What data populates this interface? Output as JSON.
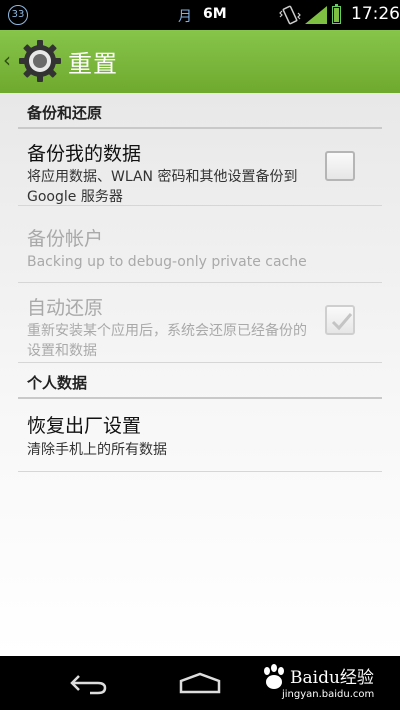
{
  "status_bar": {
    "notification_count": "33",
    "calendar_glyph": "月",
    "data_indicator": "6M",
    "time": "17:26",
    "icons": [
      "vibrate-icon",
      "signal-icon",
      "battery-icon"
    ]
  },
  "action_bar": {
    "title": "重置",
    "icon": "settings-gear-icon",
    "accent": "#7cb83d"
  },
  "sections": {
    "backup": {
      "header": "备份和还原"
    },
    "personal": {
      "header": "个人数据"
    }
  },
  "prefs": {
    "backup_data": {
      "title": "备份我的数据",
      "summary": "将应用数据、WLAN 密码和其他设置备份到 Google 服务器",
      "checked": false,
      "enabled": true
    },
    "backup_account": {
      "title": "备份帐户",
      "summary": "Backing up to debug-only private cache",
      "enabled": false
    },
    "auto_restore": {
      "title": "自动还原",
      "summary": "重新安装某个应用后，系统会还原已经备份的设置和数据",
      "checked": true,
      "enabled": false
    },
    "factory_reset": {
      "title": "恢复出厂设置",
      "summary": "清除手机上的所有数据",
      "enabled": true
    }
  },
  "watermark": {
    "brand": "Baidu经验",
    "url": "jingyan.baidu.com"
  }
}
